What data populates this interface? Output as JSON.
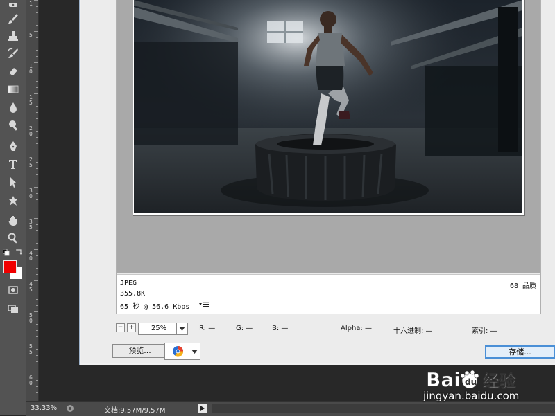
{
  "tools": [
    {
      "name": "spot-healing-icon"
    },
    {
      "name": "brush-icon"
    },
    {
      "name": "clone-stamp-icon"
    },
    {
      "name": "history-brush-icon"
    },
    {
      "name": "eraser-icon"
    },
    {
      "name": "gradient-icon"
    },
    {
      "name": "blur-icon"
    },
    {
      "name": "dodge-icon"
    },
    {
      "name": "pen-icon"
    },
    {
      "name": "type-icon"
    },
    {
      "name": "path-select-icon"
    },
    {
      "name": "shape-icon"
    },
    {
      "name": "hand-icon"
    },
    {
      "name": "zoom-icon"
    }
  ],
  "colors": {
    "foreground": "#f00000",
    "background": "#ffffff",
    "accent": "#4a8fd6"
  },
  "ruler": {
    "labels": [
      "1",
      "5",
      "1\n0",
      "1\n5",
      "2\n0",
      "2\n5",
      "3\n0",
      "3\n5",
      "4\n0",
      "4\n5",
      "5\n0",
      "5\n5",
      "6\n0"
    ]
  },
  "info": {
    "format": "JPEG",
    "size": "355.8K",
    "speed": "65 秒 @ 56.6 Kbps",
    "quality": "68 品质"
  },
  "zoom": {
    "value": "25%",
    "minus": "−",
    "plus": "+"
  },
  "stats": {
    "r": "R: —",
    "g": "G: —",
    "b": "B: —",
    "alpha": "Alpha: —",
    "hex": "十六进制: —",
    "index": "索引: —"
  },
  "buttons": {
    "preview": "预览...",
    "save": "存储..."
  },
  "browser_icon": "browser-icon",
  "document": {
    "zoom": "33.33%",
    "size": "文档:9.57M/9.57M"
  },
  "watermark": {
    "logo": "Baidu 经验",
    "url": "jingyan.baidu.com"
  }
}
